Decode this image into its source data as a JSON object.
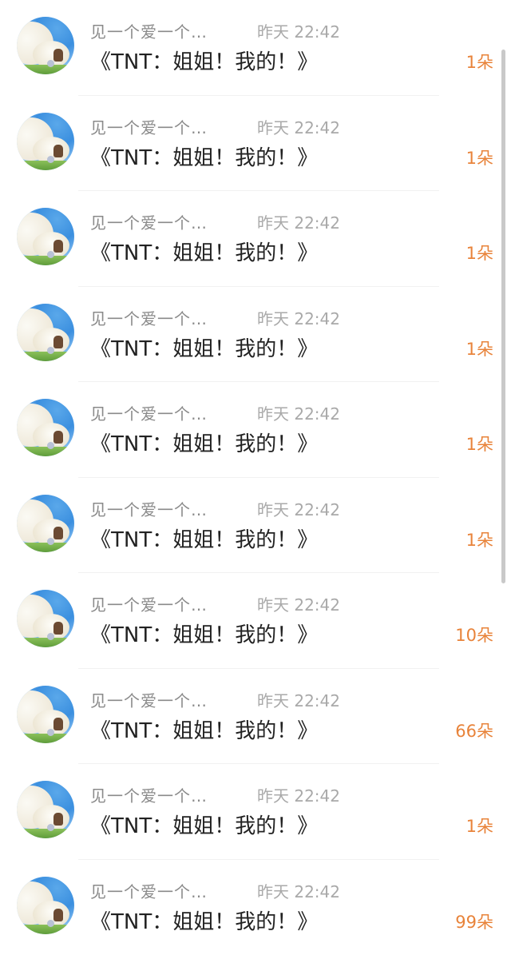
{
  "accent_color": "#e8833a",
  "items": [
    {
      "name": "见一个爱一个…",
      "time": "昨天 22:42",
      "title": "《TNT：姐姐！我的！》",
      "count": "1朵",
      "avatar": "cloud-avatar"
    },
    {
      "name": "见一个爱一个…",
      "time": "昨天 22:42",
      "title": "《TNT：姐姐！我的！》",
      "count": "1朵",
      "avatar": "cloud-avatar"
    },
    {
      "name": "见一个爱一个…",
      "time": "昨天 22:42",
      "title": "《TNT：姐姐！我的！》",
      "count": "1朵",
      "avatar": "cloud-avatar"
    },
    {
      "name": "见一个爱一个…",
      "time": "昨天 22:42",
      "title": "《TNT：姐姐！我的！》",
      "count": "1朵",
      "avatar": "cloud-avatar"
    },
    {
      "name": "见一个爱一个…",
      "time": "昨天 22:42",
      "title": "《TNT：姐姐！我的！》",
      "count": "1朵",
      "avatar": "cloud-avatar"
    },
    {
      "name": "见一个爱一个…",
      "time": "昨天 22:42",
      "title": "《TNT：姐姐！我的！》",
      "count": "1朵",
      "avatar": "cloud-avatar"
    },
    {
      "name": "见一个爱一个…",
      "time": "昨天 22:42",
      "title": "《TNT：姐姐！我的！》",
      "count": "10朵",
      "avatar": "cloud-avatar"
    },
    {
      "name": "见一个爱一个…",
      "time": "昨天 22:42",
      "title": "《TNT：姐姐！我的！》",
      "count": "66朵",
      "avatar": "cloud-avatar"
    },
    {
      "name": "见一个爱一个…",
      "time": "昨天 22:42",
      "title": "《TNT：姐姐！我的！》",
      "count": "1朵",
      "avatar": "cloud-avatar"
    },
    {
      "name": "见一个爱一个…",
      "time": "昨天 22:42",
      "title": "《TNT：姐姐！我的！》",
      "count": "99朵",
      "avatar": "cloud-avatar"
    }
  ]
}
